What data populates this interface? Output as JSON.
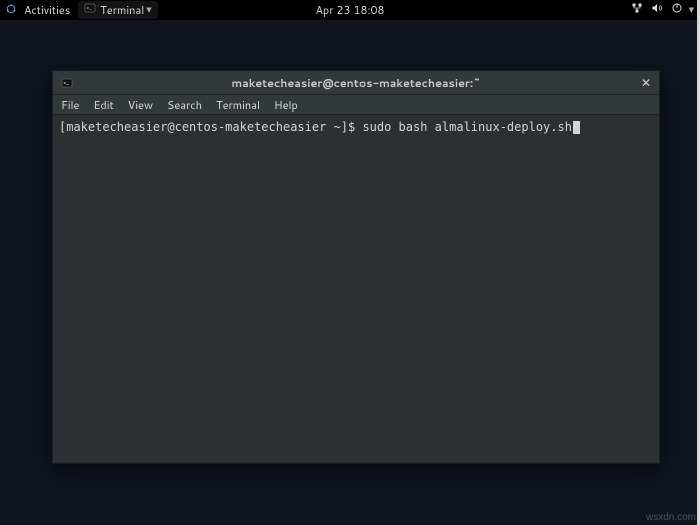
{
  "topbar": {
    "activities": "Activities",
    "app_name": "Terminal",
    "clock": "Apr 23  18:08"
  },
  "window": {
    "title": "maketecheasier@centos-maketecheasier:~",
    "menu": {
      "file": "File",
      "edit": "Edit",
      "view": "View",
      "search": "Search",
      "terminal": "Terminal",
      "help": "Help"
    }
  },
  "terminal": {
    "prompt": "[maketecheasier@centos-maketecheasier ~]$ ",
    "command": "sudo bash almalinux-deploy.sh"
  },
  "watermark": "wsxdn.com"
}
